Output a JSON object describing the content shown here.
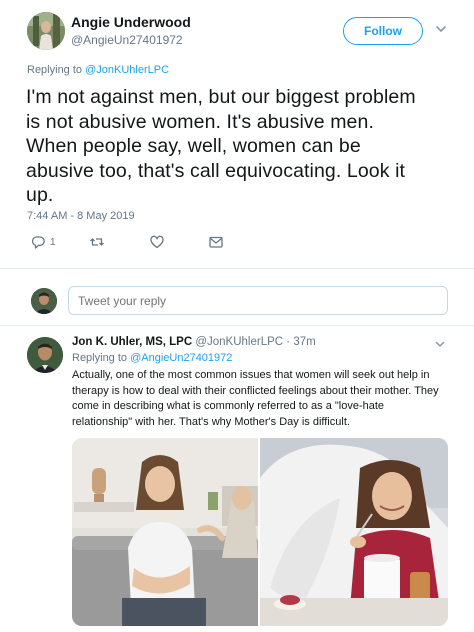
{
  "main_tweet": {
    "author_name": "Angie Underwood",
    "author_handle": "@AngieUn27401972",
    "follow_label": "Follow",
    "replying_prefix": "Replying to ",
    "replying_mention": "@JonKUhlerLPC",
    "text_lines": [
      "I'm not against men, but our biggest problem",
      "is not abusive women.  It's abusive men.",
      "When people say, well, women can be",
      "abusive too, that's call equivocating.  Look it",
      "up."
    ],
    "timestamp": "7:44 AM - 8 May 2019",
    "actions": {
      "reply_count": "1",
      "icons": [
        "reply-icon",
        "retweet-icon",
        "like-icon",
        "message-icon"
      ]
    }
  },
  "reply_box": {
    "placeholder": "Tweet your reply"
  },
  "reply_tweet": {
    "author_name": "Jon K. Uhler, MS, LPC",
    "author_handle": "@JonKUhlerLPC",
    "time_ago": "37m",
    "separator": " · ",
    "replying_prefix": "Replying to ",
    "replying_mention": "@AngieUn27401972",
    "text_lines": [
      "Actually, one of the most common issues that women will seek out help in",
      "therapy is how to deal with their conflicted feelings about their mother. They",
      "come in describing what is commonly referred to as a \"love-hate",
      "relationship\" with her. That's why Mother's Day is difficult."
    ]
  },
  "colors": {
    "accent": "#1da1f2",
    "muted": "#657786",
    "text": "#14171a",
    "divider": "#e6ecf0"
  }
}
